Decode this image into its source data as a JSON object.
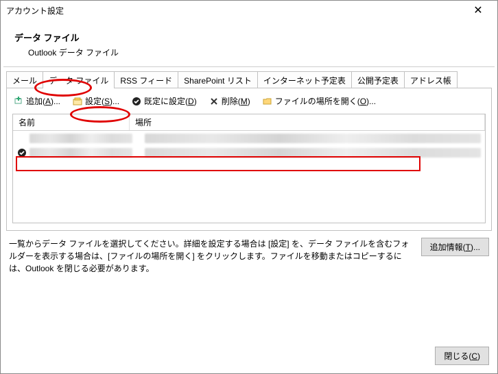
{
  "window": {
    "title": "アカウント設定"
  },
  "header": {
    "title": "データ ファイル",
    "subtitle": "Outlook データ ファイル"
  },
  "tabs": {
    "items": [
      {
        "label": "メール"
      },
      {
        "label": "データ ファイル"
      },
      {
        "label": "RSS フィード"
      },
      {
        "label": "SharePoint リスト"
      },
      {
        "label": "インターネット予定表"
      },
      {
        "label": "公開予定表"
      },
      {
        "label": "アドレス帳"
      }
    ],
    "active_index": 1
  },
  "toolbar": {
    "add": {
      "label": "追加(",
      "key": "A",
      "suffix": ")..."
    },
    "settings": {
      "label": "設定(",
      "key": "S",
      "suffix": ")..."
    },
    "default": {
      "label": "既定に設定(",
      "key": "D",
      "suffix": ")"
    },
    "remove": {
      "label": "削除(",
      "key": "M",
      "suffix": ")"
    },
    "open": {
      "label": "ファイルの場所を開く(",
      "key": "O",
      "suffix": ")..."
    }
  },
  "list": {
    "columns": {
      "name": "名前",
      "location": "場所"
    }
  },
  "footer": {
    "text": "一覧からデータ ファイルを選択してください。詳細を設定する場合は [設定] を、データ ファイルを含むフォルダーを表示する場合は、[ファイルの場所を開く] をクリックします。ファイルを移動またはコピーするには、Outlook を閉じる必要があります。",
    "more_info": {
      "label": "追加情報(",
      "key": "T",
      "suffix": ")..."
    }
  },
  "buttons": {
    "close": {
      "label": "閉じる(",
      "key": "C",
      "suffix": ")"
    }
  }
}
